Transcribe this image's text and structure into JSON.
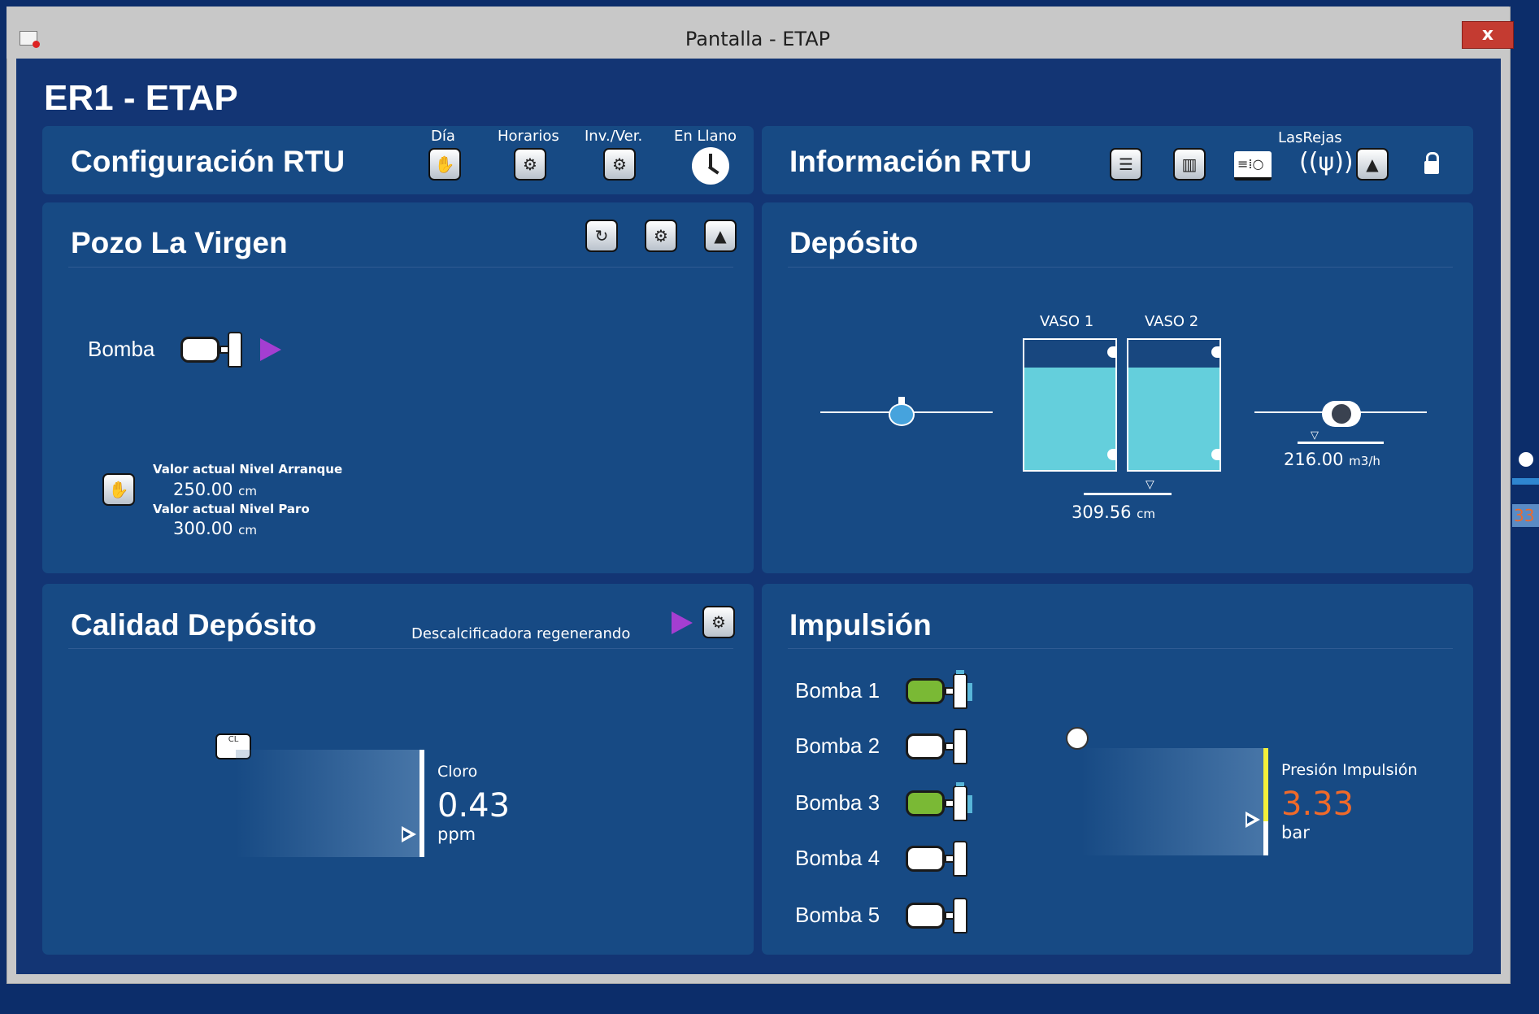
{
  "window": {
    "title": "Pantalla - ETAP",
    "close_label": "x"
  },
  "screen": {
    "title": "ER1 - ETAP"
  },
  "config_rtu": {
    "title": "Configuración RTU",
    "buttons": [
      {
        "label": "Día",
        "icon": "hand-icon"
      },
      {
        "label": "Horarios",
        "icon": "gear-m-icon"
      },
      {
        "label": "Inv./Ver.",
        "icon": "gear-m-icon"
      },
      {
        "label": "En Llano",
        "icon": "clock-icon"
      }
    ]
  },
  "info_rtu": {
    "title": "Información RTU",
    "radio_label": "LasRejas",
    "icons": [
      "list-icon",
      "chart-icon",
      "device-icon",
      "antenna-icon",
      "alarm-icon",
      "lock-icon"
    ]
  },
  "pozo": {
    "title": "Pozo La Virgen",
    "pump_label": "Bomba",
    "pump_running": true,
    "arranque_label": "Valor actual Nivel Arranque",
    "arranque_value": "250.00",
    "arranque_unit": "cm",
    "paro_label": "Valor actual Nivel Paro",
    "paro_value": "300.00",
    "paro_unit": "cm"
  },
  "deposito": {
    "title": "Depósito",
    "vaso1_label": "VASO 1",
    "vaso2_label": "VASO 2",
    "level_value": "309.56",
    "level_unit": "cm",
    "flow_value": "216.00",
    "flow_unit": "m3/h"
  },
  "calidad": {
    "title": "Calidad Depósito",
    "status_text": "Descalcificadora regenerando",
    "cloro_label": "Cloro",
    "cloro_value": "0.43",
    "cloro_unit": "ppm"
  },
  "impulsion": {
    "title": "Impulsión",
    "pumps": [
      {
        "label": "Bomba 1",
        "on": true
      },
      {
        "label": "Bomba 2",
        "on": false
      },
      {
        "label": "Bomba 3",
        "on": true
      },
      {
        "label": "Bomba 4",
        "on": false
      },
      {
        "label": "Bomba 5",
        "on": false
      }
    ],
    "presion_label": "Presión Impulsión",
    "presion_value": "3.33",
    "presion_unit": "bar"
  },
  "colors": {
    "accent_orange": "#f06a2a",
    "tank_water": "#64cfdc",
    "pump_on": "#7ab935",
    "run_arrow": "#a43ed1"
  },
  "side_value": "33"
}
